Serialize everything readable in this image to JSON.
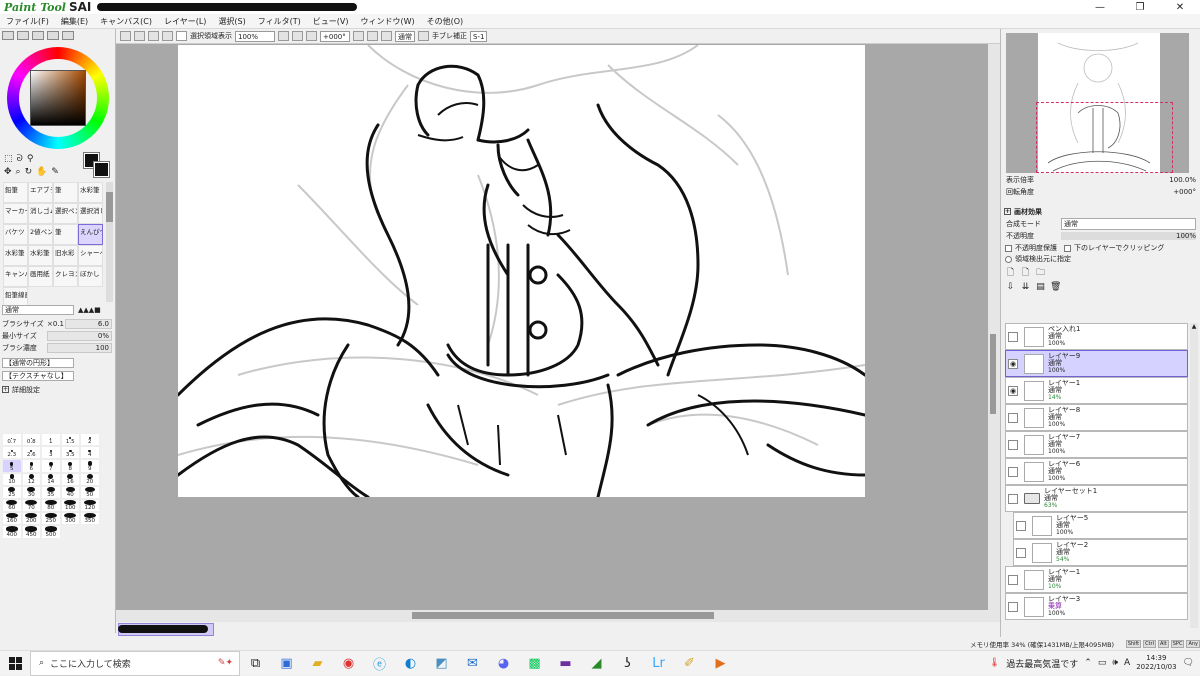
{
  "titlebar": {
    "app_name": "Paint Tool",
    "app_short": "SAI",
    "min": "—",
    "max": "❐",
    "close": "✕"
  },
  "menu": [
    "ファイル(F)",
    "編集(E)",
    "キャンバス(C)",
    "レイヤー(L)",
    "選択(S)",
    "フィルタ(T)",
    "ビュー(V)",
    "ウィンドウ(W)",
    "その他(O)"
  ],
  "toolbar": {
    "selection_display": "選択領域表示",
    "zoom": "100%",
    "rotation": "+000°",
    "blend": "通常",
    "stabilizer_label": "手ブレ補正",
    "stabilizer_value": "S-1"
  },
  "brushes": [
    {
      "label": "鉛筆"
    },
    {
      "label": "エアブラシ"
    },
    {
      "label": "筆"
    },
    {
      "label": "水彩筆"
    },
    {
      "label": "マーカー"
    },
    {
      "label": "消しゴム"
    },
    {
      "label": "選択ペン"
    },
    {
      "label": "選択消し"
    },
    {
      "label": "バケツ"
    },
    {
      "label": "2値ペン"
    },
    {
      "label": "筆"
    },
    {
      "label": "えんぴつ"
    },
    {
      "label": "水彩筆"
    },
    {
      "label": "水彩筆"
    },
    {
      "label": "旧水彩"
    },
    {
      "label": "シャーペ"
    },
    {
      "label": "キャンバス"
    },
    {
      "label": "画用紙"
    },
    {
      "label": "クレヨン"
    },
    {
      "label": "ぼかし"
    },
    {
      "label": "鉛筆線画"
    }
  ],
  "brush_props": {
    "mode": "通常",
    "size_label": "ブラシサイズ",
    "size_mult": "×0.1",
    "size_value": "6.0",
    "min_size_label": "最小サイズ",
    "min_size_value": "0%",
    "density_label": "ブラシ濃度",
    "density_value": "100",
    "shape": "【通常の円形】",
    "texture": "【テクスチャなし】",
    "detail": "詳細設定"
  },
  "brush_sizes": [
    "0.7",
    "0.8",
    "1",
    "1.5",
    "2",
    "2.3",
    "2.6",
    "3",
    "3.5",
    "4",
    "5",
    "6",
    "7",
    "8",
    "9",
    "10",
    "12",
    "14",
    "16",
    "20",
    "25",
    "30",
    "35",
    "40",
    "50",
    "60",
    "70",
    "80",
    "100",
    "120",
    "160",
    "200",
    "250",
    "300",
    "350",
    "400",
    "450",
    "500"
  ],
  "navigator": {
    "zoom_label": "表示倍率",
    "zoom_value": "100.0%",
    "angle_label": "回転角度",
    "angle_value": "+000°"
  },
  "layer_props": {
    "effects": "画材効果",
    "blend_label": "合成モード",
    "blend_value": "通常",
    "opacity_label": "不透明度",
    "opacity_value": "100%",
    "protect": "不透明度保護",
    "clip": "下のレイヤーでクリッピング",
    "source": "領域検出元に指定"
  },
  "layers": [
    {
      "name": "ペン入れ1",
      "mode": "通常",
      "opacity": "100%",
      "visible": false,
      "selected": false,
      "child": false,
      "folder": false
    },
    {
      "name": "レイヤー9",
      "mode": "通常",
      "opacity": "100%",
      "visible": true,
      "selected": true,
      "child": false,
      "folder": false
    },
    {
      "name": "レイヤー1",
      "mode": "通常",
      "opacity": "14%",
      "visible": true,
      "selected": false,
      "child": false,
      "folder": false
    },
    {
      "name": "レイヤー8",
      "mode": "通常",
      "opacity": "100%",
      "visible": false,
      "selected": false,
      "child": false,
      "folder": false
    },
    {
      "name": "レイヤー7",
      "mode": "通常",
      "opacity": "100%",
      "visible": false,
      "selected": false,
      "child": false,
      "folder": false
    },
    {
      "name": "レイヤー6",
      "mode": "通常",
      "opacity": "100%",
      "visible": false,
      "selected": false,
      "child": false,
      "folder": false
    },
    {
      "name": "レイヤーセット1",
      "mode": "通常",
      "opacity": "63%",
      "visible": false,
      "selected": false,
      "child": false,
      "folder": true
    },
    {
      "name": "レイヤー5",
      "mode": "通常",
      "opacity": "100%",
      "visible": false,
      "selected": false,
      "child": true,
      "folder": false
    },
    {
      "name": "レイヤー2",
      "mode": "通常",
      "opacity": "54%",
      "visible": false,
      "selected": false,
      "child": true,
      "folder": false
    },
    {
      "name": "レイヤー1",
      "mode": "通常",
      "opacity": "10%",
      "visible": false,
      "selected": false,
      "child": false,
      "folder": false
    },
    {
      "name": "レイヤー3",
      "mode": "乗算",
      "opacity": "100%",
      "visible": false,
      "selected": false,
      "child": false,
      "folder": false
    }
  ],
  "status": {
    "memory": "メモリ使用率 34% (確保1431MB/上限4095MB)",
    "keys": [
      "Shift",
      "Ctrl",
      "Alt",
      "SPC",
      "Any"
    ]
  },
  "taskbar": {
    "search_placeholder": "ここに入力して検索",
    "weather": "過去最高気温です",
    "time": "14:39",
    "date": "2022/10/03",
    "ime": "A"
  }
}
